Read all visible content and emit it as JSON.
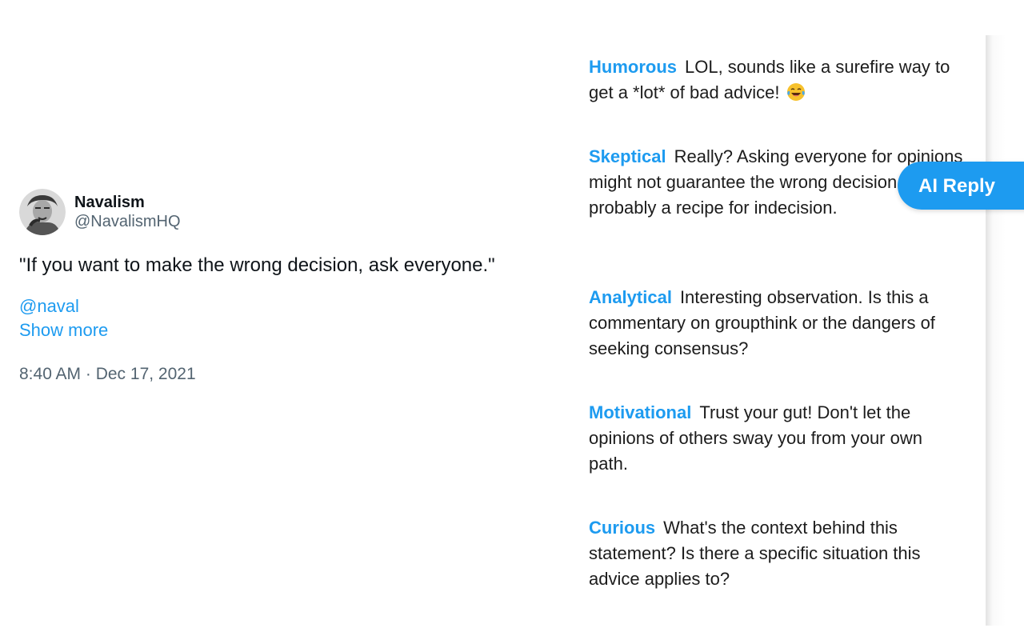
{
  "tweet": {
    "author_name": "Navalism",
    "author_handle": "@NavalismHQ",
    "text": "\"If you want to make the wrong decision, ask everyone.\"",
    "mention": "@naval",
    "show_more": "Show more",
    "timestamp": "8:40 AM · Dec 17, 2021"
  },
  "ai_button": {
    "label": "AI Reply"
  },
  "replies": [
    {
      "tone": "Humorous",
      "text": "LOL, sounds like a surefire way to get a *lot* of bad advice!",
      "emoji": "laughing-tears-icon"
    },
    {
      "tone": "Skeptical",
      "text": "Really? Asking everyone for opinions might not guarantee the wrong decision, but it's probably a recipe for indecision."
    },
    {
      "tone": "Analytical",
      "text": "Interesting observation.  Is this a commentary on groupthink or the dangers of seeking consensus?"
    },
    {
      "tone": "Motivational",
      "text": "Trust your gut!  Don't let the opinions of others sway you from your own path."
    },
    {
      "tone": "Curious",
      "text": "What's the context behind this statement?  Is there a specific situation this advice applies to?"
    }
  ],
  "colors": {
    "accent": "#1d9bf0",
    "text": "#0f1419",
    "muted": "#536471"
  }
}
